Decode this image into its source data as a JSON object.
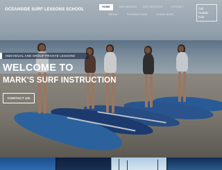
{
  "header": {
    "logo": "OCEANSIDE SURF LESSONS SCHOOL",
    "nav": [
      {
        "label": "HOME",
        "active": true
      },
      {
        "label": "OUR MISSION",
        "active": false
      },
      {
        "label": "OUR SERVICES",
        "active": false
      },
      {
        "label": "CONTACT",
        "active": false
      },
      {
        "label": "MEDIA",
        "active": false
      },
      {
        "label": "PAYMENT PAGE",
        "active": false
      },
      {
        "label": "LEARN MORE",
        "active": false
      }
    ],
    "call_button": {
      "line1": "Call",
      "line2": "Outside",
      "line3": "Fold"
    }
  },
  "hero": {
    "tagline": "INDIVIDUAL AND GROUP PRIVATE LESSONS",
    "heading": "WELCOME TO",
    "subheading": "MARK'S SURF INSTRUCTION",
    "cta": "CONTACT US"
  },
  "colors": {
    "accent": "#ffffff",
    "nav_active_text": "#1f3b6e",
    "board_blue": "#2f6fb2"
  }
}
